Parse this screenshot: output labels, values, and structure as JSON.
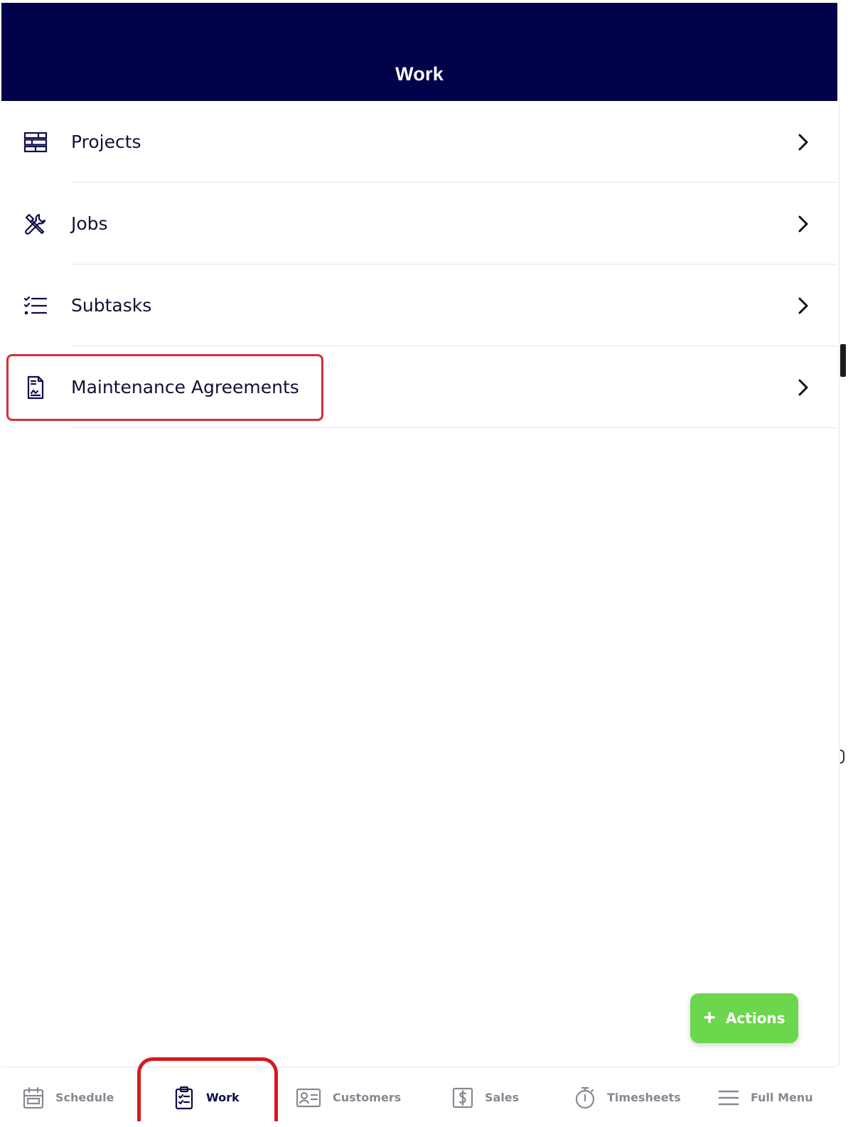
{
  "header": {
    "title": "Work"
  },
  "menu": {
    "items": [
      {
        "label": "Projects",
        "icon": "projects-icon"
      },
      {
        "label": "Jobs",
        "icon": "tools-icon"
      },
      {
        "label": "Subtasks",
        "icon": "checklist-icon"
      },
      {
        "label": "Maintenance Agreements",
        "icon": "document-icon"
      }
    ]
  },
  "fab": {
    "label": "Actions",
    "icon": "plus-icon",
    "color": "#6cd64c"
  },
  "bottom_nav": {
    "items": [
      {
        "label": "Schedule",
        "icon": "calendar-icon"
      },
      {
        "label": "Work",
        "icon": "clipboard-icon",
        "active": true
      },
      {
        "label": "Customers",
        "icon": "contact-card-icon"
      },
      {
        "label": "Sales",
        "icon": "dollar-icon"
      },
      {
        "label": "Timesheets",
        "icon": "stopwatch-icon"
      },
      {
        "label": "Full Menu",
        "icon": "hamburger-icon"
      }
    ]
  },
  "colors": {
    "header_bg": "#01024a",
    "highlight": "#d0323b",
    "accent_green": "#6cd64c"
  }
}
